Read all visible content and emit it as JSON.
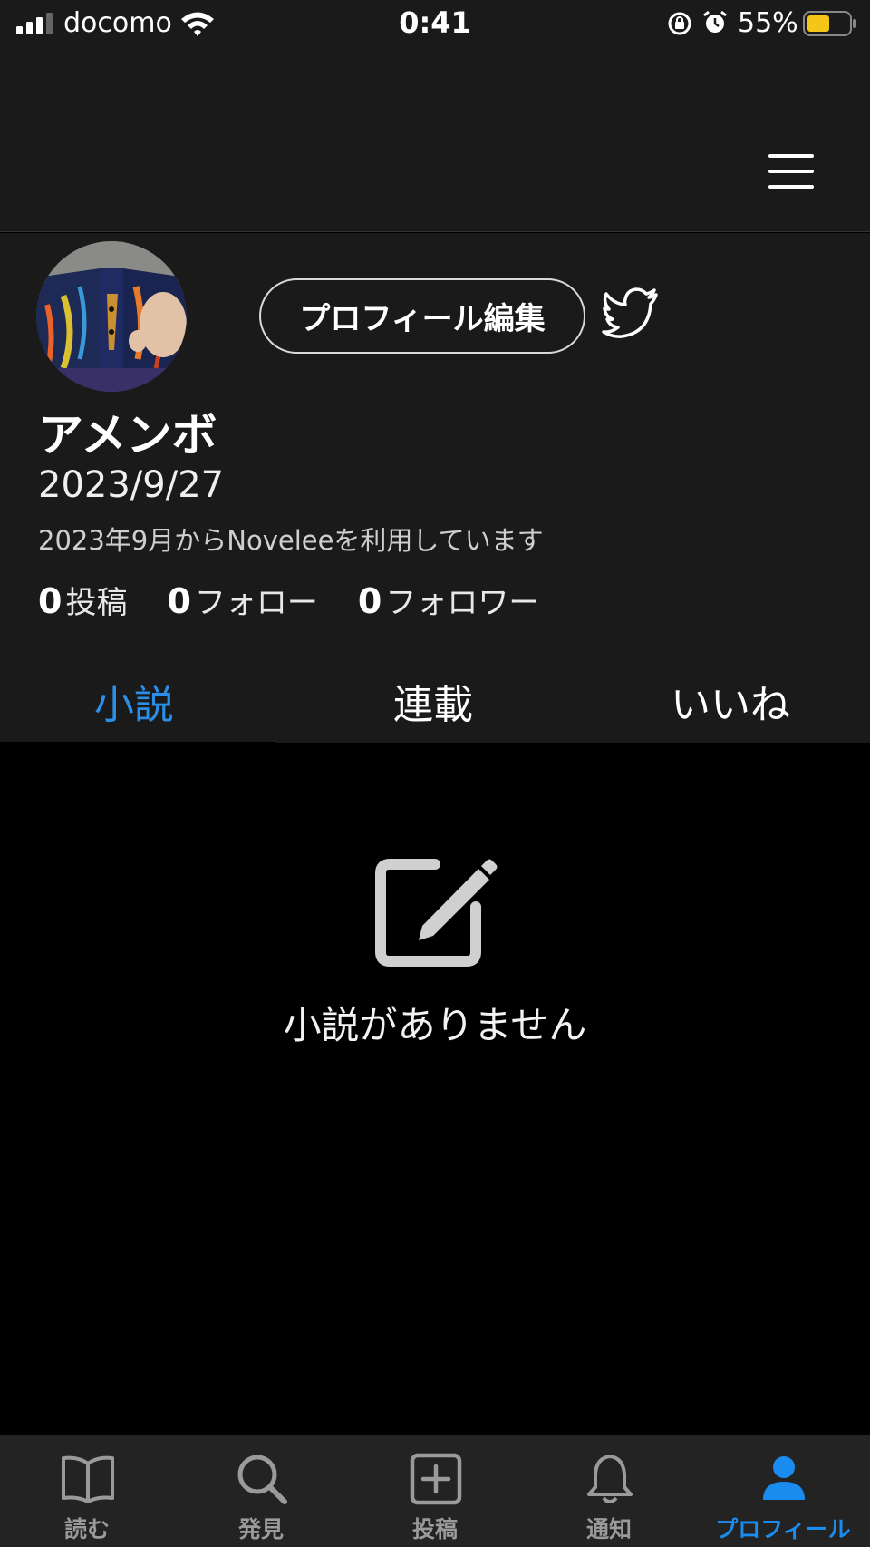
{
  "status_bar": {
    "carrier": "docomo",
    "time": "0:41",
    "battery_percent": "55%",
    "battery_level": 0.55,
    "battery_color": "#f5c518"
  },
  "header": {
    "menu_icon": "hamburger-menu-icon"
  },
  "profile": {
    "edit_button_label": "プロフィール編集",
    "twitter_icon": "twitter-icon",
    "username": "アメンボ",
    "joined_date": "2023/9/27",
    "joined_text": "2023年9月からNoveleeを利用しています",
    "stats": [
      {
        "count": "0",
        "label": "投稿"
      },
      {
        "count": "0",
        "label": "フォロー"
      },
      {
        "count": "0",
        "label": "フォロワー"
      }
    ]
  },
  "tabs": [
    {
      "label": "小説",
      "active": true
    },
    {
      "label": "連載",
      "active": false
    },
    {
      "label": "いいね",
      "active": false
    }
  ],
  "empty_state": {
    "icon": "edit-note-icon",
    "text": "小説がありません"
  },
  "bottom_nav": [
    {
      "label": "読む",
      "icon": "book-icon",
      "active": false
    },
    {
      "label": "発見",
      "icon": "search-icon",
      "active": false
    },
    {
      "label": "投稿",
      "icon": "plus-square-icon",
      "active": false
    },
    {
      "label": "通知",
      "icon": "bell-icon",
      "active": false
    },
    {
      "label": "プロフィール",
      "icon": "person-icon",
      "active": true
    }
  ],
  "colors": {
    "accent": "#2b8fe8",
    "surface": "#1a1a1a",
    "background": "#000000"
  }
}
